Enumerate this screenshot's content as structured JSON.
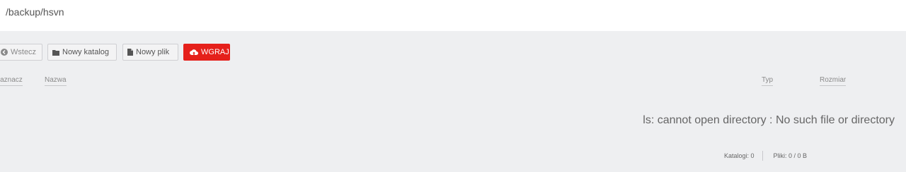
{
  "path": "/backup/hsvn",
  "toolbar": {
    "back_label": "Wstecz",
    "new_folder_label": "Nowy katalog",
    "new_file_label": "Nowy plik",
    "upload_label": "WGRAJ"
  },
  "columns": {
    "select": "Zaznacz",
    "name": "Nazwa",
    "type": "Typ",
    "size": "Rozmiar"
  },
  "error_message": "ls: cannot open directory : No such file or directory",
  "footer": {
    "folders": "Katalogi: 0",
    "files": "Pliki: 0 / 0 B"
  },
  "colors": {
    "upload_button": "#e5201b",
    "background": "#eeeff1"
  },
  "icons": {
    "back": "circle-chevron-left-icon",
    "folder": "folder-icon",
    "file": "file-icon",
    "upload": "cloud-upload-icon"
  }
}
